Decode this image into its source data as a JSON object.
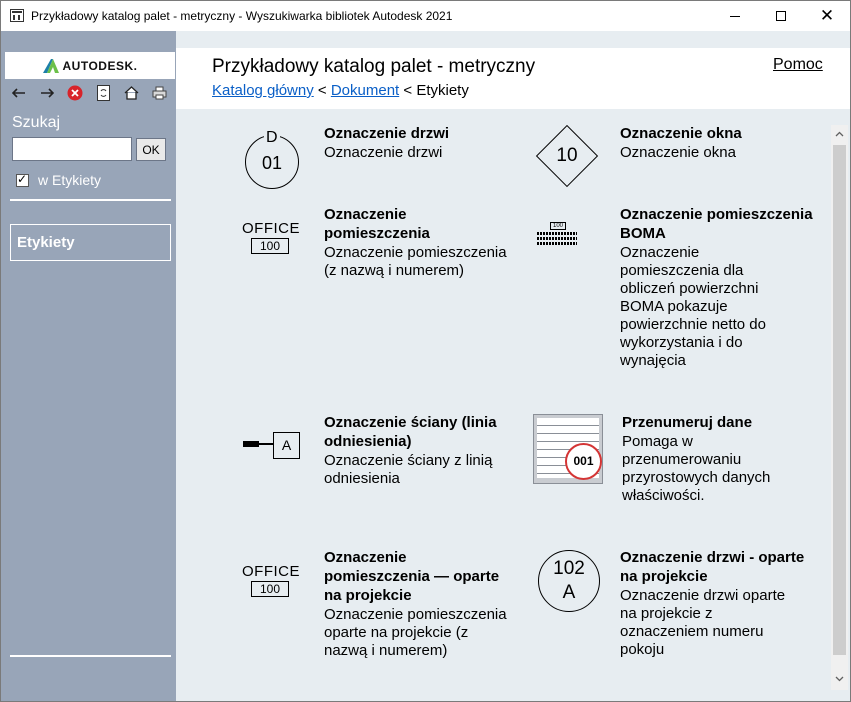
{
  "window": {
    "title": "Przykładowy katalog palet - metryczny - Wyszukiwarka bibliotek Autodesk 2021"
  },
  "sidebar": {
    "logo_text": "AUTODESK.",
    "search_label": "Szukaj",
    "search_value": "",
    "ok_label": "OK",
    "scope_label": "w Etykiety",
    "nav_item": "Etykiety"
  },
  "header": {
    "title": "Przykładowy katalog palet - metryczny",
    "help": "Pomoc",
    "breadcrumb": {
      "home": "Katalog główny",
      "sep1": " < ",
      "doc": "Dokument",
      "sep2": " < ",
      "current": "Etykiety"
    }
  },
  "items": [
    {
      "title": "Oznaczenie drzwi",
      "desc": "Oznaczenie drzwi",
      "icon": {
        "top": "D",
        "num": "01"
      }
    },
    {
      "title": "Oznaczenie okna",
      "desc": "Oznaczenie okna",
      "icon": {
        "num": "10"
      }
    },
    {
      "title": "Oznaczenie pomieszczenia",
      "desc": "Oznaczenie pomieszczenia (z nazwą i numerem)",
      "icon": {
        "text": "OFFICE",
        "num": "100"
      }
    },
    {
      "title": "Oznaczenie pomieszczenia BOMA",
      "desc": "Oznaczenie pomieszczenia dla obliczeń powierzchni BOMA pokazuje powierzchnie netto do wykorzystania i do wynajęcia",
      "icon": {
        "num": "100"
      }
    },
    {
      "title": "Oznaczenie ściany (linia odniesienia)",
      "desc": "Oznaczenie ściany z linią odniesienia",
      "icon": {
        "letter": "A"
      }
    },
    {
      "title": "Przenumeruj dane",
      "desc": "Pomaga w przenumerowaniu przyrostowych danych właściwości.",
      "icon": {
        "num": "001"
      }
    },
    {
      "title": "Oznaczenie pomieszczenia — oparte na projekcie",
      "desc": "Oznaczenie pomieszczenia oparte na projekcie (z nazwą i numerem)",
      "icon": {
        "text": "OFFICE",
        "num": "100"
      }
    },
    {
      "title": "Oznaczenie drzwi - oparte na projekcie",
      "desc": "Oznaczenie drzwi oparte na projekcie z oznaczeniem numeru pokoju",
      "icon": {
        "top": "102",
        "bottom": "A"
      }
    }
  ]
}
